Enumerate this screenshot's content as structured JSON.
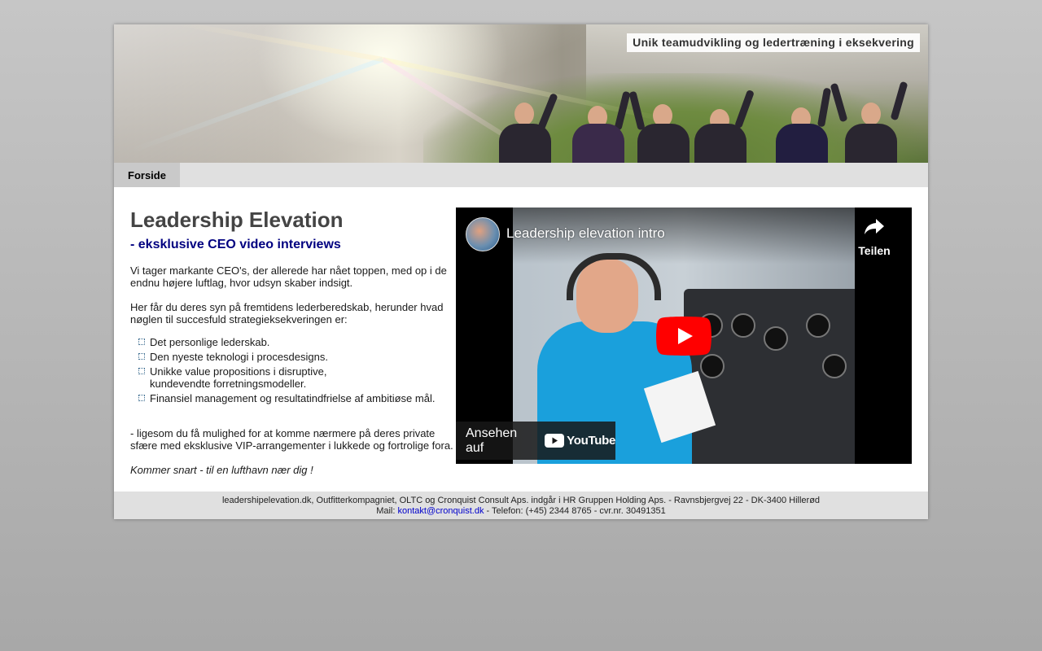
{
  "banner": {
    "caption": "Unik teamudvikling og ledertræning i eksekvering"
  },
  "nav": {
    "tabs": [
      {
        "label": "Forside",
        "active": true
      }
    ]
  },
  "main": {
    "title": "Leadership Elevation",
    "subtitle": "- eksklusive CEO video interviews",
    "paragraph1": "Vi tager markante CEO's, der allerede har nået toppen, med op i de endnu højere luftlag, hvor udsyn skaber indsigt.",
    "paragraph2": "Her får du deres syn på fremtidens lederberedskab, herunder hvad nøglen til succesfuld strategieksekveringen er:",
    "bullets": [
      "Det personlige lederskab.",
      "Den nyeste teknologi i procesdesigns.",
      "Unikke value propositions i disruptive, kundevendte forretningsmodeller.",
      "Finansiel management og resultatindfrielse af ambitiøse mål."
    ],
    "paragraph3": "- ligesom du få mulighed for at komme nærmere på deres private sfære med eksklusive VIP-arrangementer i lukkede og fortrolige fora.",
    "paragraph4": "Kommer snart - til en lufthavn nær dig !"
  },
  "video": {
    "title": "Leadership elevation intro",
    "share_label": "Teilen",
    "watch_on": "Ansehen auf",
    "platform": "YouTube",
    "icons": [
      "share-icon",
      "play-icon",
      "youtube-logo-icon"
    ]
  },
  "footer": {
    "line1": "leadershipelevation.dk, Outfitterkompagniet, OLTC og Cronquist Consult Aps. indgår i HR Gruppen Holding Aps. - Ravnsbjergvej 22 - DK-3400 Hillerød",
    "mail_prefix": "Mail:",
    "mail_link": "kontakt@cronquist.dk",
    "line2_suffix": "- Telefon: (+45) 2344 8765 - cvr.nr. 30491351"
  },
  "colors": {
    "subtitle": "#000080",
    "link": "#0000cc",
    "nav_bar": "#e0e0e0",
    "nav_tab_active": "#c9c9c9",
    "youtube_red": "#ff0000"
  }
}
